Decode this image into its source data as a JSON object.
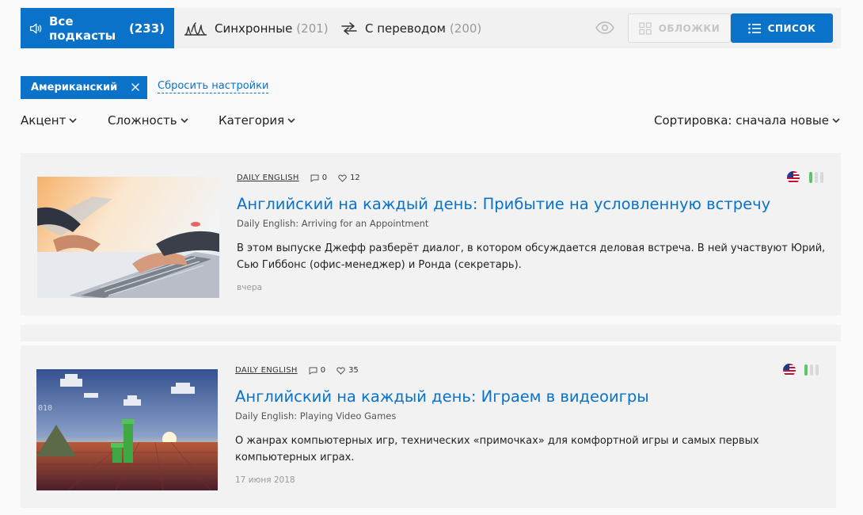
{
  "tabs": [
    {
      "label": "Все подкасты",
      "count": "(233)"
    },
    {
      "label": "Синхронные",
      "count": "(201)"
    },
    {
      "label": "С переводом",
      "count": "(200)"
    }
  ],
  "view": {
    "covers": "ОБЛОЖКИ",
    "list": "СПИСОК"
  },
  "filter": {
    "chip": "Американский",
    "reset": "Сбросить настройки"
  },
  "dropdowns": {
    "accent": "Акцент",
    "level": "Сложность",
    "category": "Категория",
    "sort": "Сортировка: сначала новые"
  },
  "colors": {
    "accent": "#0a73c9",
    "level_on": "#5fc46a"
  },
  "podcasts": [
    {
      "source": "DAILY ENGLISH",
      "comments": "0",
      "likes": "12",
      "title": "Английский на каждый день: Прибытие на условленную встречу",
      "subtitle": "Daily English: Arriving for an Appointment",
      "description": "В этом выпуске Джефф разберёт диалог, в котором обсуждается деловая встреча. В ней участвуют Юрий, Сью Гиббонс (офис-менеджер) и Ронда (секретарь).",
      "date": "вчера",
      "level": 1,
      "level_of": 3,
      "flag": "us-flag-icon"
    },
    {
      "source": "DAILY ENGLISH",
      "comments": "0",
      "likes": "35",
      "title": "Английский на каждый день: Играем в видеоигры",
      "subtitle": "Daily English: Playing Video Games",
      "description": "О жанрах компьютерных игр, технических «примочках» для комфортной игры и самых первых компьютерных играх.",
      "date": "17 июня 2018",
      "level": 1,
      "level_of": 3,
      "flag": "us-flag-icon"
    }
  ]
}
